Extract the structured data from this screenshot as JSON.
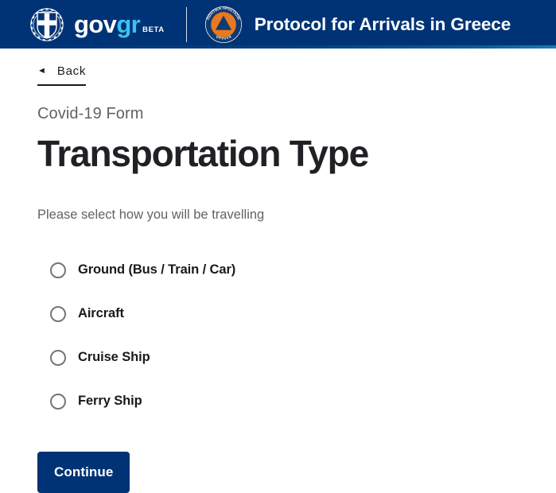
{
  "header": {
    "logo_text_gov": "gov",
    "logo_text_gr": "gr",
    "logo_badge": "BETA",
    "hellenic_emblem_name": "hellenic-republic-coat-of-arms",
    "civil_protection_emblem_name": "civil-protection-greece-emblem",
    "civil_protection_text_top": "ΠΟΛΙΤΙΚΗ ΠΡΟΣΤΑΣΙΑ",
    "civil_protection_text_bottom": "ΕΛΛΑΔΑ",
    "title": "Protocol for Arrivals in Greece",
    "background_color": "#003375",
    "accent_color": "#3dc1f2"
  },
  "navigation": {
    "back_label": "Back",
    "back_arrow_glyph": "◄"
  },
  "form": {
    "eyebrow": "Covid-19 Form",
    "title": "Transportation Type",
    "instructions": "Please select how you will be travelling",
    "options": [
      {
        "label": "Ground (Bus / Train / Car)",
        "selected": false
      },
      {
        "label": "Aircraft",
        "selected": false
      },
      {
        "label": "Cruise Ship",
        "selected": false
      },
      {
        "label": "Ferry Ship",
        "selected": false
      }
    ],
    "submit_label": "Continue",
    "submit_color": "#003375"
  }
}
